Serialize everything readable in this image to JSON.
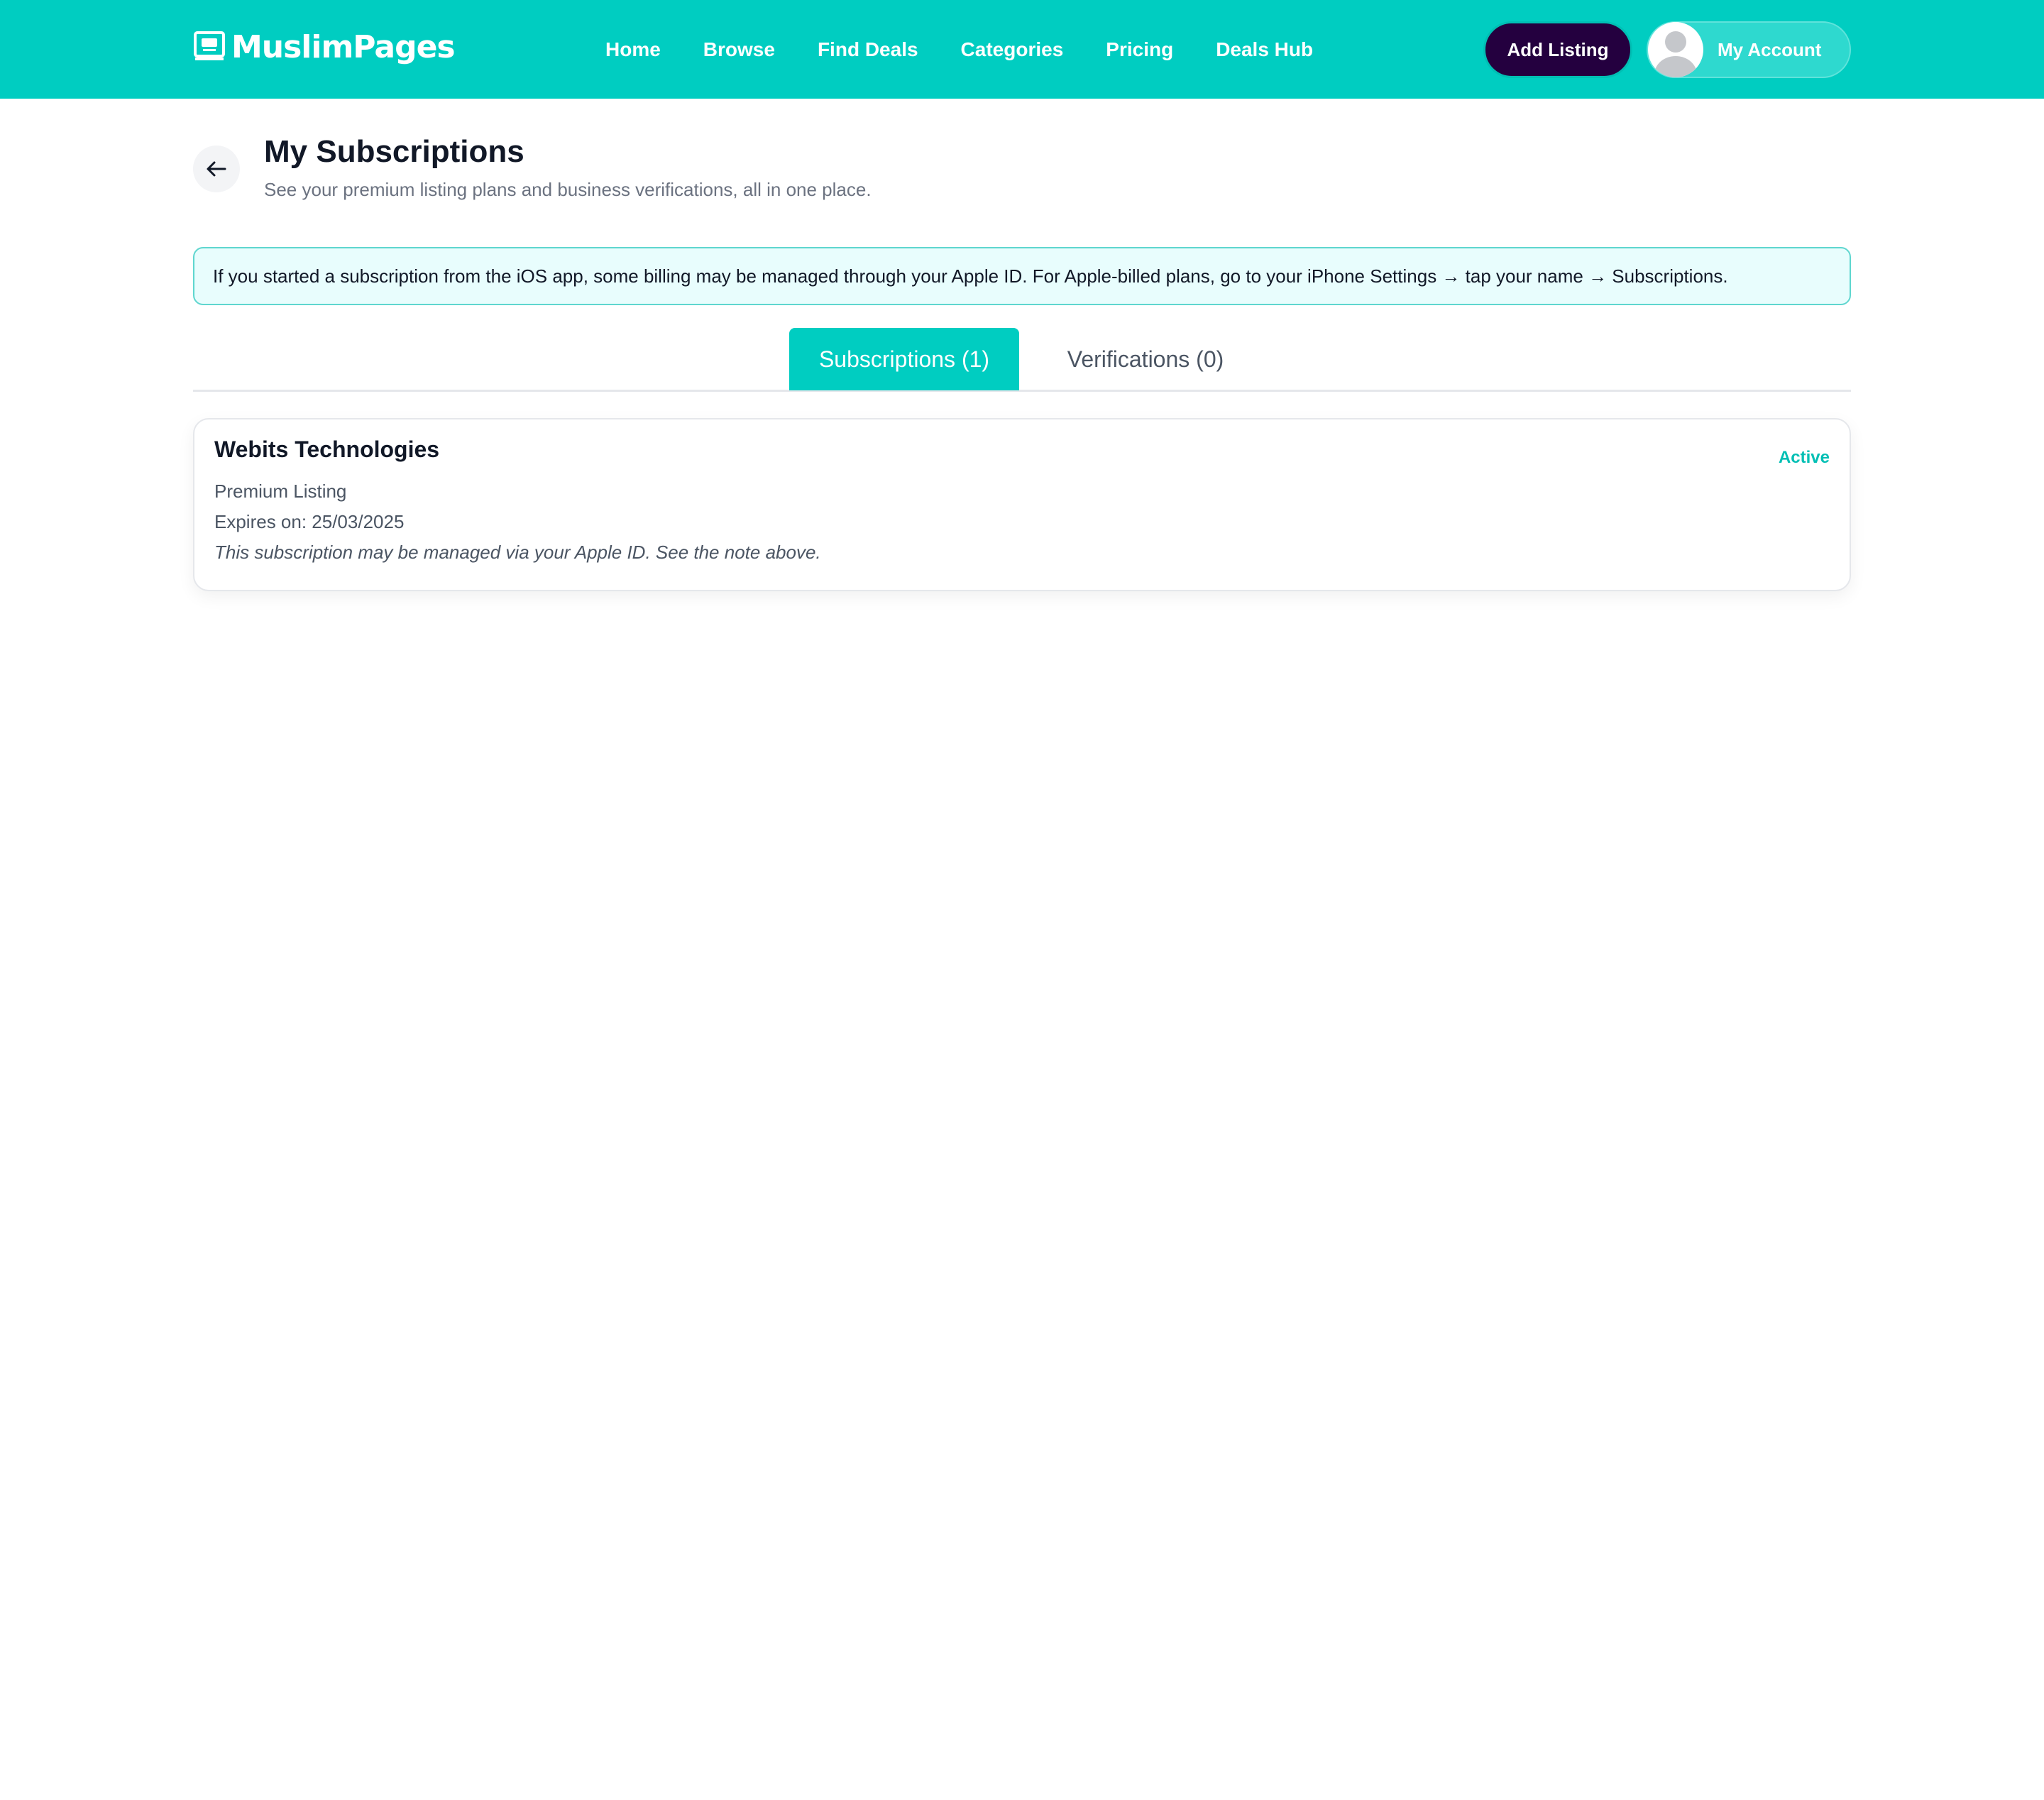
{
  "header": {
    "logo_text": "MuslimPages",
    "nav": [
      "Home",
      "Browse",
      "Find Deals",
      "Categories",
      "Pricing",
      "Deals Hub"
    ],
    "add_listing_label": "Add Listing",
    "account_label": "My Account",
    "brand_color": "#00CDC1",
    "add_listing_color": "#24003F"
  },
  "page": {
    "title": "My Subscriptions",
    "subtitle": "See your premium listing plans and business verifications, all in one place."
  },
  "notice": {
    "text": "If you started a subscription from the iOS app, some billing may be managed through your Apple ID. For Apple-billed plans, go to your iPhone Settings → tap your name → Subscriptions."
  },
  "tabs": [
    {
      "label": "Subscriptions (1)",
      "active": true
    },
    {
      "label": "Verifications (0)",
      "active": false
    }
  ],
  "subscriptions": [
    {
      "business": "Webits Technologies",
      "status": "Active",
      "plan": "Premium Listing",
      "expires": "Expires on: 25/03/2025",
      "note": "This subscription may be managed via your Apple ID. See the note above."
    }
  ]
}
